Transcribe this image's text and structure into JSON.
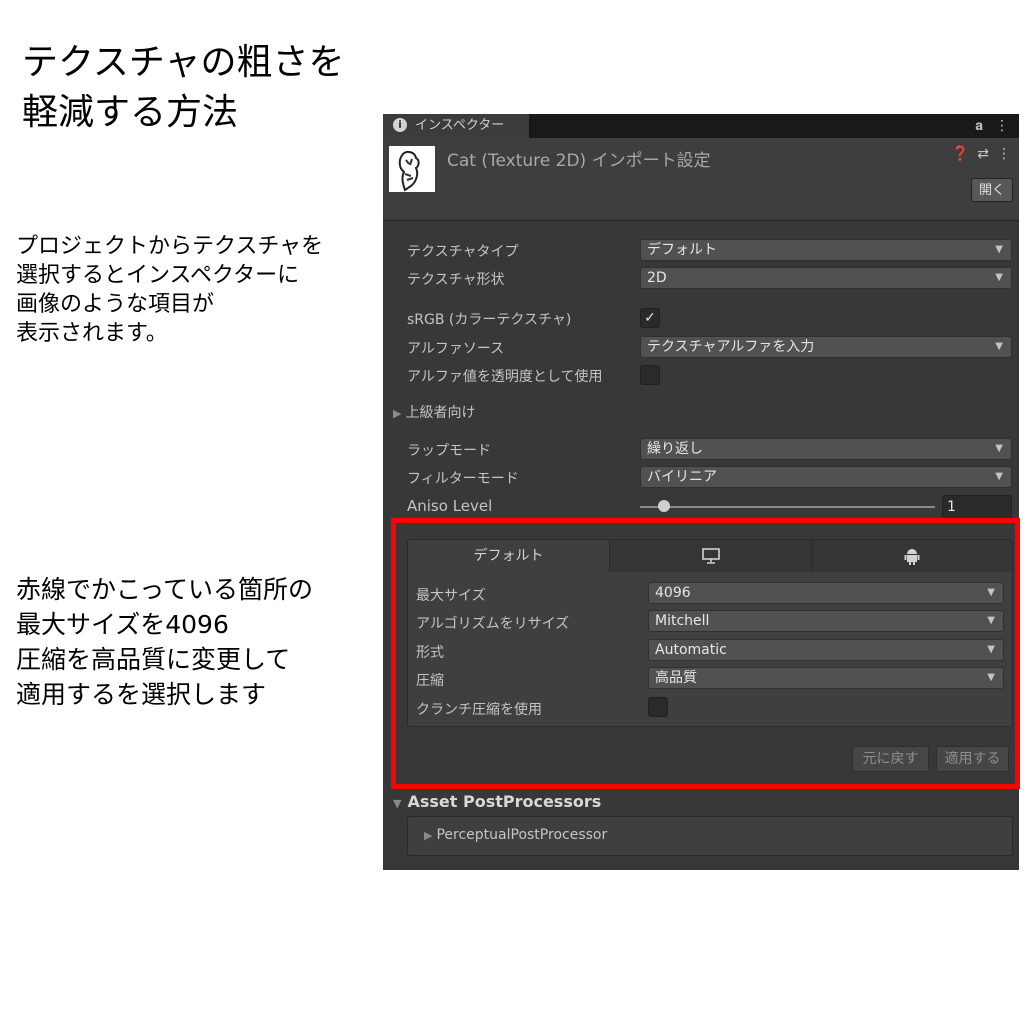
{
  "slide": {
    "title_lines": [
      "テクスチャの粗さを",
      "軽減する方法"
    ],
    "desc1_lines": [
      "プロジェクトからテクスチャを",
      "選択するとインスペクターに",
      "画像のような項目が",
      "表示されます。"
    ],
    "desc2_lines": [
      "赤線でかこっている箇所の",
      "最大サイズを4096",
      "圧縮を高品質に変更して",
      "適用するを選択します"
    ]
  },
  "inspector": {
    "tab_label": "インスペクター",
    "tab_icon": "info-icon",
    "header_title": "Cat (Texture 2D) インポート設定",
    "open_button": "開く",
    "fields": {
      "texture_type": {
        "label": "テクスチャタイプ",
        "value": "デフォルト"
      },
      "texture_shape": {
        "label": "テクスチャ形状",
        "value": "2D"
      },
      "srgb": {
        "label": "sRGB (カラーテクスチャ)",
        "checked": true
      },
      "alpha_source": {
        "label": "アルファソース",
        "value": "テクスチャアルファを入力"
      },
      "alpha_transparency": {
        "label": "アルファ値を透明度として使用",
        "checked": false
      },
      "advanced": {
        "label": "上級者向け"
      },
      "wrap_mode": {
        "label": "ラップモード",
        "value": "繰り返し"
      },
      "filter_mode": {
        "label": "フィルターモード",
        "value": "バイリニア"
      },
      "aniso_level": {
        "label": "Aniso Level",
        "value": "1"
      }
    },
    "platform": {
      "tab_default": "デフォルト",
      "tab_icons": [
        "monitor-icon",
        "android-icon"
      ],
      "max_size": {
        "label": "最大サイズ",
        "value": "4096"
      },
      "resize_algorithm": {
        "label": "アルゴリズムをリサイズ",
        "value": "Mitchell"
      },
      "format": {
        "label": "形式",
        "value": "Automatic"
      },
      "compression": {
        "label": "圧縮",
        "value": "高品質"
      },
      "crunch": {
        "label": "クランチ圧縮を使用",
        "checked": false
      }
    },
    "revert_button": "元に戻す",
    "apply_button": "適用する",
    "asset_postprocessors": {
      "header": "Asset PostProcessors",
      "item": "PerceptualPostProcessor"
    }
  },
  "colors": {
    "highlight_frame": "#ff0000",
    "panel_bg": "#383838"
  }
}
